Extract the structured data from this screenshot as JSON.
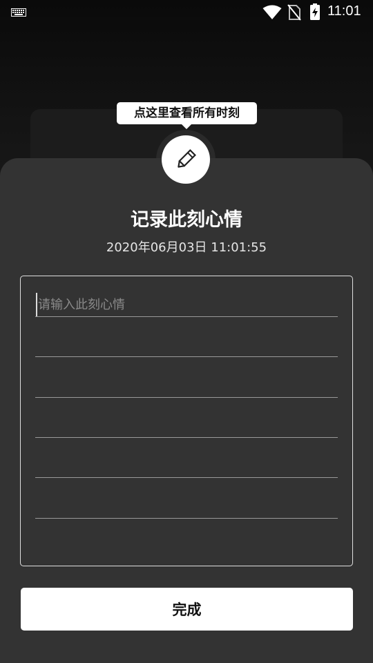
{
  "status_bar": {
    "time": "11:01",
    "icons": [
      "keyboard-icon",
      "wifi-icon",
      "no-sim-icon",
      "battery-charging-icon"
    ]
  },
  "tooltip": {
    "text": "点这里查看所有时刻"
  },
  "avatar": {
    "icon": "pencil-icon"
  },
  "sheet": {
    "title": "记录此刻心情",
    "datetime": "2020年06月03日 11:01:55",
    "note": {
      "value": "",
      "placeholder": "请输入此刻心情"
    },
    "done_label": "完成"
  },
  "colors": {
    "sheet_bg": "#333333",
    "page_bg": "#000000",
    "button_bg": "#ffffff",
    "placeholder": "#8a8a8a"
  }
}
